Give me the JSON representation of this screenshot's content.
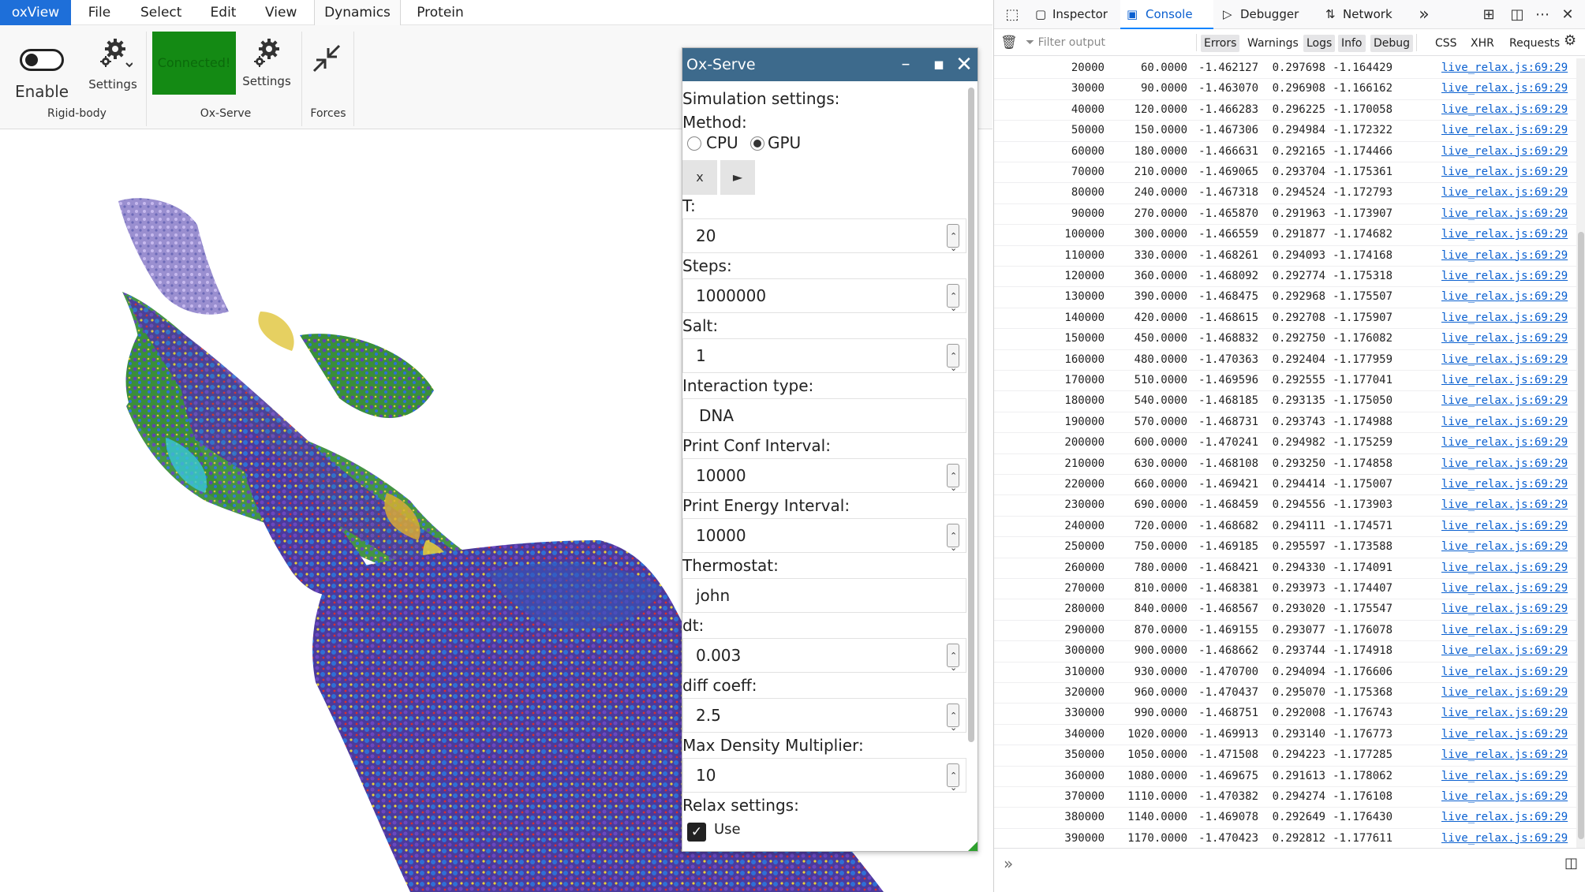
{
  "menubar": {
    "items": [
      "oxView",
      "File",
      "Select",
      "Edit",
      "View",
      "Dynamics",
      "Protein"
    ],
    "active": "Dynamics"
  },
  "ribbon": {
    "enable_label": "Enable",
    "rb_settings_label": "Settings",
    "connected_label": "Connected!",
    "ox_settings_label": "Settings",
    "groups": [
      "Rigid-body",
      "Ox-Serve",
      "Forces"
    ]
  },
  "dialog": {
    "title": "Ox-Serve",
    "simulation_heading": "Simulation settings:",
    "method_label": "Method:",
    "method_options": [
      "CPU",
      "GPU"
    ],
    "method_selected": "GPU",
    "stop_label": "x",
    "play_label": "►",
    "fields": [
      {
        "label": "T:",
        "value": "20",
        "spinner": true
      },
      {
        "label": "Steps:",
        "value": "1000000",
        "spinner": true
      },
      {
        "label": "Salt:",
        "value": "1",
        "spinner": true
      },
      {
        "label": "Interaction type:",
        "value": "DNA",
        "spinner": false
      },
      {
        "label": "Print Conf Interval:",
        "value": "10000",
        "spinner": true
      },
      {
        "label": "Print Energy Interval:",
        "value": "10000",
        "spinner": true
      },
      {
        "label": "Thermostat:",
        "value": "john",
        "spinner": false
      },
      {
        "label": "dt:",
        "value": "0.003",
        "spinner": true
      },
      {
        "label": "diff coeff:",
        "value": "2.5",
        "spinner": true
      },
      {
        "label": "Max Density Multiplier:",
        "value": "10",
        "spinner": true
      }
    ],
    "relax_heading": "Relax settings:",
    "use_label": "Use",
    "use_checked": true
  },
  "devtools": {
    "tabs": [
      "Inspector",
      "Console",
      "Debugger",
      "Network"
    ],
    "active_tab": "Console",
    "filter_placeholder": "Filter output",
    "filter_buttons": [
      "Errors",
      "Warnings",
      "Logs",
      "Info",
      "Debug",
      "CSS",
      "XHR",
      "Requests"
    ],
    "filters_on": [
      "Errors",
      "Logs",
      "Info",
      "Debug"
    ],
    "log_source": "live_relax.js:69:29",
    "log_rows": [
      [
        "20000",
        "60.0000",
        "-1.462127",
        "0.297698",
        "-1.164429"
      ],
      [
        "30000",
        "90.0000",
        "-1.463070",
        "0.296908",
        "-1.166162"
      ],
      [
        "40000",
        "120.0000",
        "-1.466283",
        "0.296225",
        "-1.170058"
      ],
      [
        "50000",
        "150.0000",
        "-1.467306",
        "0.294984",
        "-1.172322"
      ],
      [
        "60000",
        "180.0000",
        "-1.466631",
        "0.292165",
        "-1.174466"
      ],
      [
        "70000",
        "210.0000",
        "-1.469065",
        "0.293704",
        "-1.175361"
      ],
      [
        "80000",
        "240.0000",
        "-1.467318",
        "0.294524",
        "-1.172793"
      ],
      [
        "90000",
        "270.0000",
        "-1.465870",
        "0.291963",
        "-1.173907"
      ],
      [
        "100000",
        "300.0000",
        "-1.466559",
        "0.291877",
        "-1.174682"
      ],
      [
        "110000",
        "330.0000",
        "-1.468261",
        "0.294093",
        "-1.174168"
      ],
      [
        "120000",
        "360.0000",
        "-1.468092",
        "0.292774",
        "-1.175318"
      ],
      [
        "130000",
        "390.0000",
        "-1.468475",
        "0.292968",
        "-1.175507"
      ],
      [
        "140000",
        "420.0000",
        "-1.468615",
        "0.292708",
        "-1.175907"
      ],
      [
        "150000",
        "450.0000",
        "-1.468832",
        "0.292750",
        "-1.176082"
      ],
      [
        "160000",
        "480.0000",
        "-1.470363",
        "0.292404",
        "-1.177959"
      ],
      [
        "170000",
        "510.0000",
        "-1.469596",
        "0.292555",
        "-1.177041"
      ],
      [
        "180000",
        "540.0000",
        "-1.468185",
        "0.293135",
        "-1.175050"
      ],
      [
        "190000",
        "570.0000",
        "-1.468731",
        "0.293743",
        "-1.174988"
      ],
      [
        "200000",
        "600.0000",
        "-1.470241",
        "0.294982",
        "-1.175259"
      ],
      [
        "210000",
        "630.0000",
        "-1.468108",
        "0.293250",
        "-1.174858"
      ],
      [
        "220000",
        "660.0000",
        "-1.469421",
        "0.294414",
        "-1.175007"
      ],
      [
        "230000",
        "690.0000",
        "-1.468459",
        "0.294556",
        "-1.173903"
      ],
      [
        "240000",
        "720.0000",
        "-1.468682",
        "0.294111",
        "-1.174571"
      ],
      [
        "250000",
        "750.0000",
        "-1.469185",
        "0.295597",
        "-1.173588"
      ],
      [
        "260000",
        "780.0000",
        "-1.468421",
        "0.294330",
        "-1.174091"
      ],
      [
        "270000",
        "810.0000",
        "-1.468381",
        "0.293973",
        "-1.174407"
      ],
      [
        "280000",
        "840.0000",
        "-1.468567",
        "0.293020",
        "-1.175547"
      ],
      [
        "290000",
        "870.0000",
        "-1.469155",
        "0.293077",
        "-1.176078"
      ],
      [
        "300000",
        "900.0000",
        "-1.468662",
        "0.293744",
        "-1.174918"
      ],
      [
        "310000",
        "930.0000",
        "-1.470700",
        "0.294094",
        "-1.176606"
      ],
      [
        "320000",
        "960.0000",
        "-1.470437",
        "0.295070",
        "-1.175368"
      ],
      [
        "330000",
        "990.0000",
        "-1.468751",
        "0.292008",
        "-1.176743"
      ],
      [
        "340000",
        "1020.0000",
        "-1.469913",
        "0.293140",
        "-1.176773"
      ],
      [
        "350000",
        "1050.0000",
        "-1.471508",
        "0.294223",
        "-1.177285"
      ],
      [
        "360000",
        "1080.0000",
        "-1.469675",
        "0.291613",
        "-1.178062"
      ],
      [
        "370000",
        "1110.0000",
        "-1.470382",
        "0.294274",
        "-1.176108"
      ],
      [
        "380000",
        "1140.0000",
        "-1.469078",
        "0.292649",
        "-1.176430"
      ],
      [
        "390000",
        "1170.0000",
        "-1.470423",
        "0.292812",
        "-1.177611"
      ]
    ]
  },
  "colors": {
    "brand": "#1e6fd9",
    "connected": "#148a14",
    "dialog_title": "#3d6a8c",
    "link": "#0a60d0",
    "molecule_purple": "#5b3ea6",
    "molecule_blue": "#2f6fd6",
    "molecule_green": "#2e9d2e",
    "molecule_yellow": "#e8d23a",
    "molecule_red": "#d83030"
  }
}
